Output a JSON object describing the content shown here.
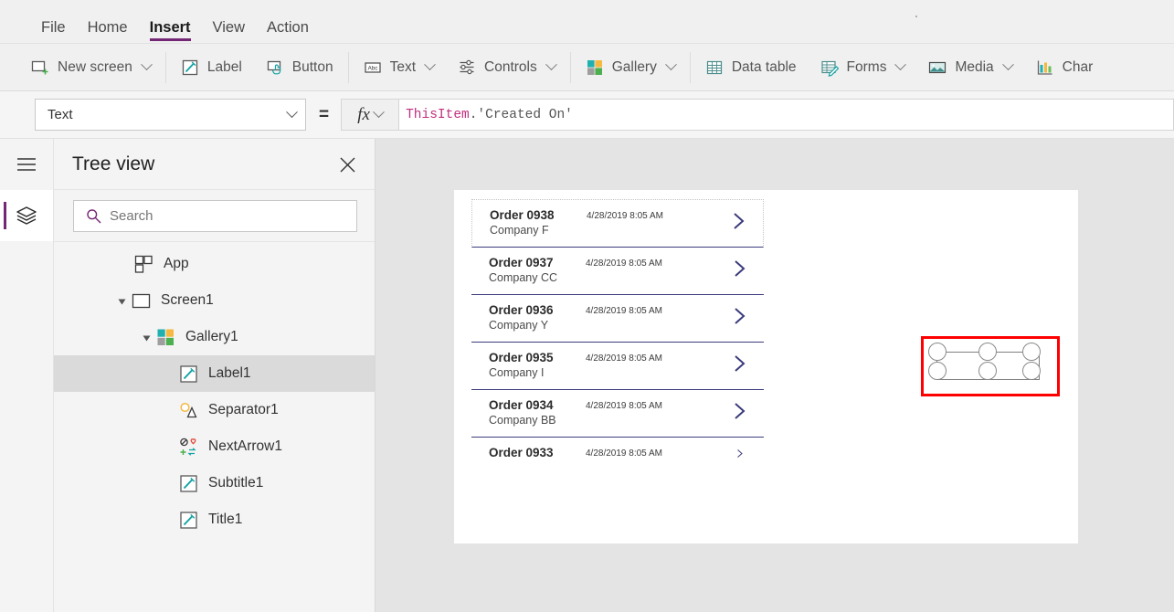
{
  "menu": {
    "items": [
      {
        "label": "File",
        "active": false
      },
      {
        "label": "Home",
        "active": false
      },
      {
        "label": "Insert",
        "active": true
      },
      {
        "label": "View",
        "active": false
      },
      {
        "label": "Action",
        "active": false
      }
    ]
  },
  "ribbon": {
    "items": [
      {
        "label": "New screen",
        "icon": "new-screen-icon",
        "dropdown": true
      },
      {
        "label": "Label",
        "icon": "label-icon",
        "dropdown": false
      },
      {
        "label": "Button",
        "icon": "button-icon",
        "dropdown": false
      },
      {
        "label": "Text",
        "icon": "text-abc-icon",
        "dropdown": true
      },
      {
        "label": "Controls",
        "icon": "controls-sliders-icon",
        "dropdown": true
      },
      {
        "label": "Gallery",
        "icon": "gallery-grid-icon",
        "dropdown": true
      },
      {
        "label": "Data table",
        "icon": "data-table-icon",
        "dropdown": false
      },
      {
        "label": "Forms",
        "icon": "forms-icon",
        "dropdown": true
      },
      {
        "label": "Media",
        "icon": "media-image-icon",
        "dropdown": true
      },
      {
        "label": "Char",
        "icon": "charts-bar-icon",
        "dropdown": false
      }
    ]
  },
  "property_bar": {
    "selected_property": "Text",
    "equals_sign": "=",
    "fx_label": "fx",
    "formula_tokens": [
      {
        "text": "ThisItem",
        "type": "this-item"
      },
      {
        "text": ".'Created On'",
        "type": "plain"
      }
    ]
  },
  "left_rail": {
    "hamburger": "hamburger-menu-icon",
    "active_button": "tree-view-layers-icon"
  },
  "tree_view": {
    "title": "Tree view",
    "close_label": "close-icon",
    "search": {
      "placeholder": "Search",
      "icon": "search-icon"
    },
    "items": [
      {
        "label": "App",
        "icon": "app-icon",
        "level": 0,
        "twisty": false,
        "selected": false
      },
      {
        "label": "Screen1",
        "icon": "screen-icon",
        "level": 1,
        "twisty": true,
        "selected": false
      },
      {
        "label": "Gallery1",
        "icon": "gallery-grid-icon",
        "level": 2,
        "twisty": true,
        "selected": false
      },
      {
        "label": "Label1",
        "icon": "label-pencil-icon",
        "level": 3,
        "twisty": false,
        "selected": true
      },
      {
        "label": "Separator1",
        "icon": "separator-shapes-icon",
        "level": 3,
        "twisty": false,
        "selected": false
      },
      {
        "label": "NextArrow1",
        "icon": "next-arrow-icons-icon",
        "level": 3,
        "twisty": false,
        "selected": false
      },
      {
        "label": "Subtitle1",
        "icon": "label-pencil-icon",
        "level": 3,
        "twisty": false,
        "selected": false
      },
      {
        "label": "Title1",
        "icon": "label-pencil-icon",
        "level": 3,
        "twisty": false,
        "selected": false
      }
    ]
  },
  "canvas": {
    "gallery_rows": [
      {
        "title": "Order 0938",
        "subtitle": "Company F",
        "date": "4/28/2019 8:05 AM",
        "selected": true,
        "clipped": false
      },
      {
        "title": "Order 0937",
        "subtitle": "Company CC",
        "date": "4/28/2019 8:05 AM",
        "selected": false,
        "clipped": false
      },
      {
        "title": "Order 0936",
        "subtitle": "Company Y",
        "date": "4/28/2019 8:05 AM",
        "selected": false,
        "clipped": false
      },
      {
        "title": "Order 0935",
        "subtitle": "Company I",
        "date": "4/28/2019 8:05 AM",
        "selected": false,
        "clipped": false
      },
      {
        "title": "Order 0934",
        "subtitle": "Company BB",
        "date": "4/28/2019 8:05 AM",
        "selected": false,
        "clipped": false
      },
      {
        "title": "Order 0933",
        "subtitle": "",
        "date": "4/28/2019 8:05 AM",
        "selected": false,
        "clipped": true
      }
    ]
  },
  "colors": {
    "accent_purple": "#742774",
    "selection_red": "#ff0000",
    "chevron_navy": "#3b3b7d",
    "formula_token_pink": "#c0307f",
    "canvas_backdrop": "#e4e4e4",
    "panel_background": "#f4f4f4",
    "tree_selected_row": "#dadada"
  }
}
